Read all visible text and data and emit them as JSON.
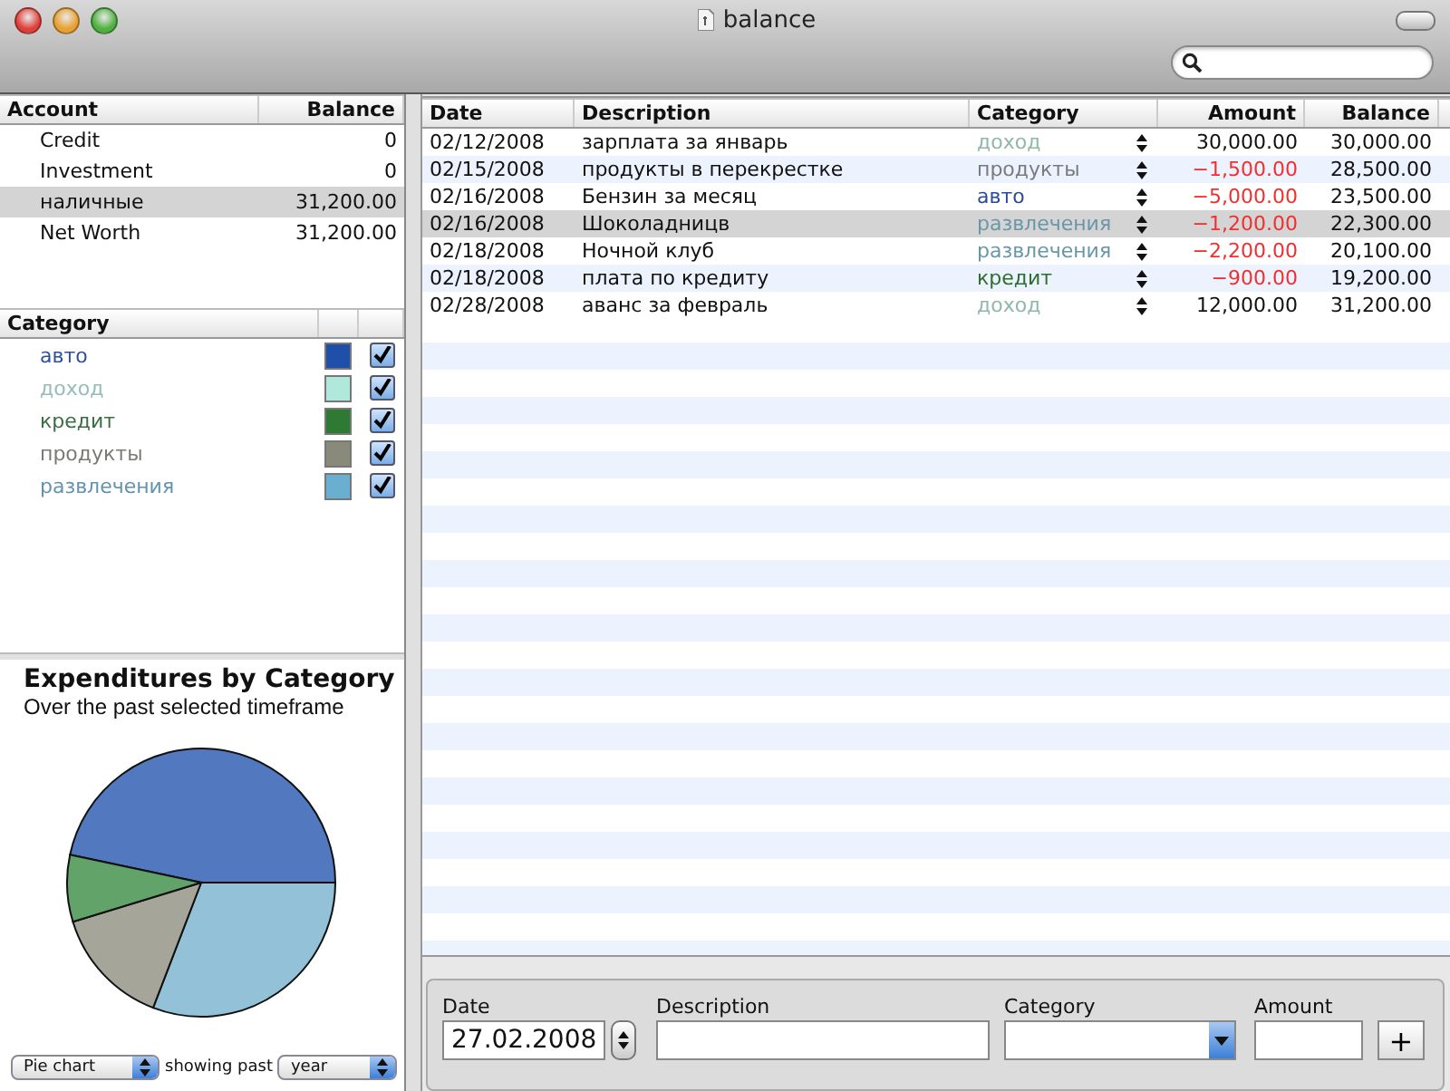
{
  "window": {
    "title": "balance"
  },
  "accounts": {
    "columns": [
      "Account",
      "Balance"
    ],
    "rows": [
      {
        "name": "Credit",
        "balance": "0",
        "selected": false
      },
      {
        "name": "Investment",
        "balance": "0",
        "selected": false
      },
      {
        "name": "наличные",
        "balance": "31,200.00",
        "selected": true
      },
      {
        "name": "Net Worth",
        "balance": "31,200.00",
        "selected": false
      }
    ]
  },
  "categories": {
    "column": "Category",
    "rows": [
      {
        "name": "авто",
        "color": "#1f4fa8",
        "checked": true
      },
      {
        "name": "доход",
        "color": "#b0e8dc",
        "checked": true
      },
      {
        "name": "кредит",
        "color": "#2e7a34",
        "checked": true
      },
      {
        "name": "продукты",
        "color": "#8a8a7a",
        "checked": true
      },
      {
        "name": "развлечения",
        "color": "#6aaed0",
        "checked": true
      }
    ]
  },
  "expenditures": {
    "title": "Expenditures by Category",
    "subtitle": "Over the past selected timeframe"
  },
  "chart_controls": {
    "chart_type": "Pie chart",
    "label": "showing past",
    "period": "year"
  },
  "transactions": {
    "columns": [
      "Date",
      "Description",
      "Category",
      "Amount",
      "Balance"
    ],
    "rows": [
      {
        "date": "02/12/2008",
        "description": "зарплата за январь",
        "category": "доход",
        "color": "#8fb8a8",
        "amount": "30,000.00",
        "negative": false,
        "balance": "30,000.00",
        "selected": false
      },
      {
        "date": "02/15/2008",
        "description": "продукты в перекрестке",
        "category": "продукты",
        "color": "#7a7a7a",
        "amount": "−1,500.00",
        "negative": true,
        "balance": "28,500.00",
        "selected": false
      },
      {
        "date": "02/16/2008",
        "description": "Бензин за месяц",
        "category": "авто",
        "color": "#2a4a9a",
        "amount": "−5,000.00",
        "negative": true,
        "balance": "23,500.00",
        "selected": false
      },
      {
        "date": "02/16/2008",
        "description": "Шоколадницв",
        "category": "развлечения",
        "color": "#6a97a8",
        "amount": "−1,200.00",
        "negative": true,
        "balance": "22,300.00",
        "selected": true
      },
      {
        "date": "02/18/2008",
        "description": "Ночной клуб",
        "category": "развлечения",
        "color": "#6a97a8",
        "amount": "−2,200.00",
        "negative": true,
        "balance": "20,100.00",
        "selected": false
      },
      {
        "date": "02/18/2008",
        "description": "плата по кредиту",
        "category": "кредит",
        "color": "#2e6e2e",
        "amount": "−900.00",
        "negative": true,
        "balance": "19,200.00",
        "selected": false
      },
      {
        "date": "02/28/2008",
        "description": "аванс за февраль",
        "category": "доход",
        "color": "#8fb8a8",
        "amount": "12,000.00",
        "negative": false,
        "balance": "31,200.00",
        "selected": false
      }
    ]
  },
  "entry_form": {
    "date_label": "Date",
    "date_value": "27.02.2008",
    "description_label": "Description",
    "category_label": "Category",
    "amount_label": "Amount",
    "add_button": "+"
  }
}
